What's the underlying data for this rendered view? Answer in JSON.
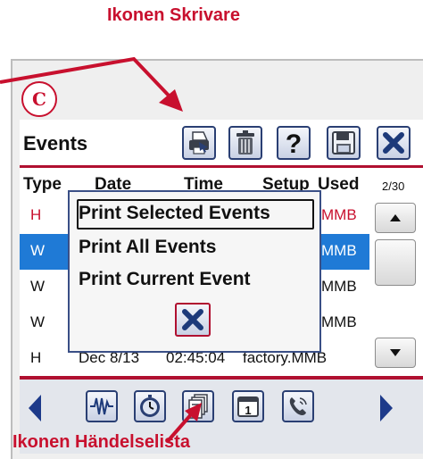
{
  "callouts": {
    "printer_icon": "Ikonen Skrivare",
    "event_list_icon": "Ikonen Händelselista"
  },
  "badge": "C",
  "header": {
    "title": "Events",
    "icons": [
      "printer-icon",
      "trash-icon",
      "help-icon",
      "save-icon",
      "close-icon"
    ]
  },
  "table": {
    "columns": [
      "Type",
      "Date",
      "Time",
      "Setup",
      "Used"
    ],
    "page_count": "2/30",
    "rows": [
      {
        "type": "H",
        "used": "MMB",
        "type_color": "#c8102e",
        "selected": false
      },
      {
        "type": "W",
        "used": "MMB",
        "type_color": "#ffffff",
        "selected": true
      },
      {
        "type": "W",
        "used": "MMB",
        "type_color": "#111111",
        "selected": false
      },
      {
        "type": "W",
        "used": "MMB",
        "type_color": "#111111",
        "selected": false
      },
      {
        "type": "H",
        "date": "Dec 8/13",
        "time": "02:45:04",
        "setup": "factory.MMB",
        "type_color": "#111111",
        "selected": false
      }
    ]
  },
  "print_menu": {
    "items": [
      "Print Selected Events",
      "Print All Events",
      "Print Current Event"
    ],
    "close_icon": "close-icon"
  },
  "navbar": {
    "icons": [
      "waveform-icon",
      "timer-icon",
      "event-list-icon",
      "calendar-icon",
      "phone-icon"
    ]
  },
  "colors": {
    "accent": "#c8102e",
    "selection": "#1f7ad6",
    "border_blue": "#2a3f73"
  }
}
